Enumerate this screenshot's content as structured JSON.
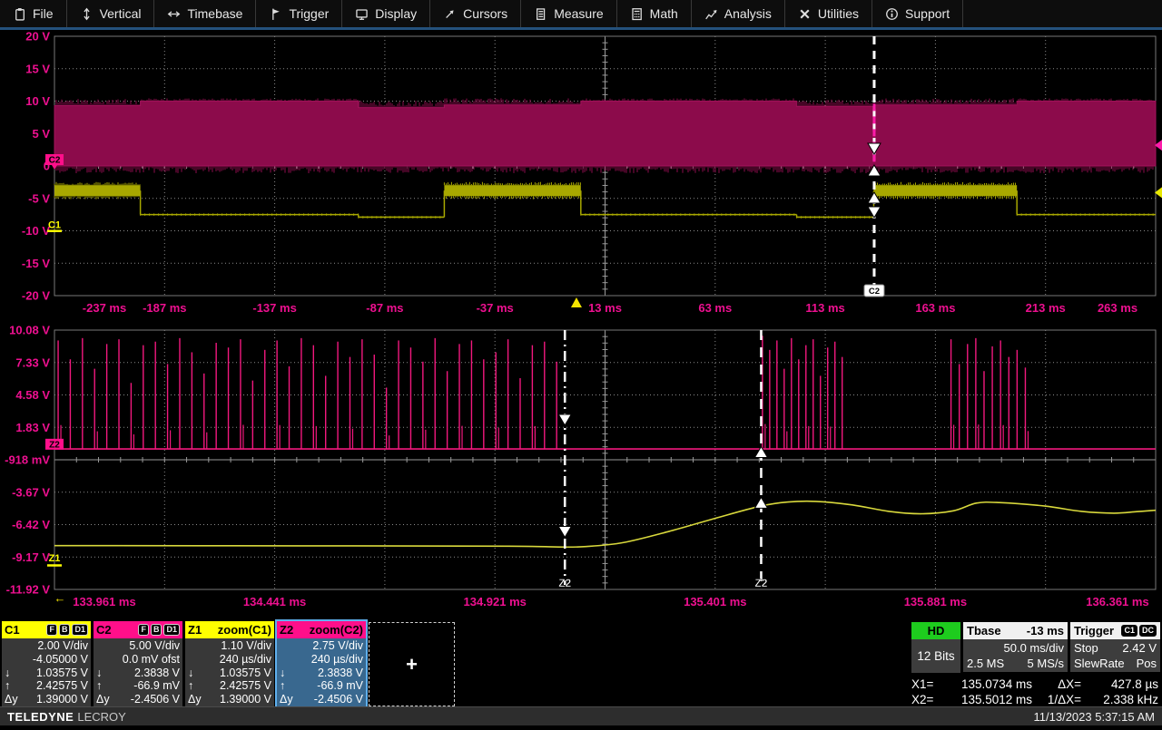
{
  "menu": {
    "items": [
      {
        "label": "File",
        "icon": "file"
      },
      {
        "label": "Vertical",
        "icon": "vertical"
      },
      {
        "label": "Timebase",
        "icon": "timebase"
      },
      {
        "label": "Trigger",
        "icon": "trigger"
      },
      {
        "label": "Display",
        "icon": "display"
      },
      {
        "label": "Cursors",
        "icon": "cursors"
      },
      {
        "label": "Measure",
        "icon": "measure"
      },
      {
        "label": "Math",
        "icon": "math"
      },
      {
        "label": "Analysis",
        "icon": "analysis"
      },
      {
        "label": "Utilities",
        "icon": "utilities"
      },
      {
        "label": "Support",
        "icon": "support"
      }
    ]
  },
  "colors": {
    "axis_pink": "#ee1090",
    "band_crimson": "#8c0b4b",
    "band_edge": "#a5135c",
    "trace_yellow": "#a8a800",
    "zoom_yellow": "#d8d83c",
    "spike_pink": "#f2187e",
    "grid_dotted": "#8a8a8a",
    "grid_center": "#9a9a9a",
    "grid_border": "#787878",
    "cursor_white": "#ffffff",
    "c1_yellow": "#ffff00",
    "c2_pink": "#ff0f8a",
    "hd_green": "#1ecc1e",
    "z1_underline": "#00b400",
    "z2_underline": "#00c8b4"
  },
  "chart_data": [
    {
      "id": "main",
      "type": "line",
      "x_unit": "ms",
      "x_range": [
        -237,
        263
      ],
      "y_range": [
        -20,
        20
      ],
      "x_divisions": 10,
      "y_divisions": 8,
      "x_ticks": [
        "-237 ms",
        "-187 ms",
        "-137 ms",
        "-87 ms",
        "-37 ms",
        "13 ms",
        "63 ms",
        "113 ms",
        "163 ms",
        "213 ms",
        "263 ms"
      ],
      "y_ticks": [
        "20 V",
        "15 V",
        "10 V",
        "5 V",
        "0",
        "-5 V",
        "-10 V",
        "-15 V",
        "-20 V"
      ],
      "grid": "dotted",
      "trigger_marker_ms": 0,
      "series": [
        {
          "name": "C2",
          "kind": "pwm-band",
          "base_v": 0,
          "top_segments_ms_v": [
            [
              -237,
              -198,
              9.3,
              2
            ],
            [
              -198,
              -99,
              10,
              1
            ],
            [
              -99,
              -60,
              9.0,
              2
            ],
            [
              -60,
              2,
              9.4,
              2
            ],
            [
              2,
              100,
              10,
              1
            ],
            [
              100,
              135,
              9.2,
              2
            ],
            [
              135,
              200,
              9.4,
              2
            ],
            [
              200,
              263,
              10,
              1
            ]
          ]
        },
        {
          "name": "C1",
          "kind": "steps",
          "segments_ms_v": [
            [
              -237,
              -198,
              -3.8,
              "thick"
            ],
            [
              -198,
              -99,
              -7.5,
              "thin"
            ],
            [
              -99,
              -60,
              -7.9,
              "thin"
            ],
            [
              -60,
              2,
              -3.8,
              "thick"
            ],
            [
              2,
              100,
              -7.5,
              "thin"
            ],
            [
              100,
              135,
              -7.9,
              "thin"
            ],
            [
              135,
              200,
              -3.8,
              "thick"
            ],
            [
              200,
              263,
              -7.5,
              "thin"
            ]
          ]
        }
      ],
      "cursor": {
        "x_ms": 135.2,
        "label": "C2",
        "style": "dashed"
      },
      "left_badges": [
        {
          "label": "C2",
          "v": 0
        },
        {
          "label": "C1",
          "v": -10
        }
      ],
      "right_markers": [
        {
          "color": "#ff1caa",
          "v": 3.2
        },
        {
          "color": "#e8e800",
          "v": -4.1
        }
      ]
    },
    {
      "id": "zoom",
      "type": "line",
      "x_unit": "ms",
      "x_range": [
        133.961,
        136.361
      ],
      "y_range": [
        -11.92,
        10.08
      ],
      "x_divisions": 10,
      "y_divisions": 8,
      "x_ticks": [
        "133.961 ms",
        "134.441 ms",
        "134.921 ms",
        "135.401 ms",
        "135.881 ms",
        "136.361 ms"
      ],
      "y_ticks": [
        "10.08 V",
        "7.33 V",
        "4.58 V",
        "1.83 V",
        "-918 mV",
        "-3.67 V",
        "-6.42 V",
        "-9.17 V",
        "-11.92 V"
      ],
      "grid": "dotted",
      "series": [
        {
          "name": "Z2",
          "kind": "spikes",
          "baseline_v": 0,
          "clusters": [
            {
              "start_ms": 133.969,
              "spacing_ms": 0.0265,
              "heights_v": [
                9.2,
                7.6,
                9.4,
                6.8,
                8.9,
                9.3,
                5.6,
                8.8,
                9.1,
                7.2,
                9.4,
                8.2,
                6.4,
                9.0,
                8.6,
                9.3,
                5.8,
                8.4,
                9.2,
                7.0,
                9.4,
                8.8,
                6.2,
                9.1,
                7.8,
                9.3,
                8.0,
                5.2,
                9.2,
                8.6,
                7.4,
                9.4,
                6.6,
                8.9,
                9.2,
                7.6,
                8.2,
                9.3,
                6.0,
                8.8,
                9.1,
                7.4
              ]
            },
            {
              "start_ms": 135.504,
              "spacing_ms": 0.0158,
              "heights_v": [
                9.6,
                8.4,
                9.2,
                6.8,
                9.4,
                7.6,
                8.8,
                9.3,
                6.2,
                8.6,
                9.1,
                7.8
              ]
            },
            {
              "start_ms": 135.915,
              "spacing_ms": 0.018,
              "heights_v": [
                9.3,
                7.2,
                8.9,
                9.4,
                6.6,
                8.7,
                9.2,
                7.8,
                8.4,
                6.9
              ]
            }
          ]
        },
        {
          "name": "Z1",
          "kind": "curve",
          "points_ms_v": [
            [
              133.961,
              -8.2
            ],
            [
              134.5,
              -8.22
            ],
            [
              134.95,
              -8.25
            ],
            [
              135.06,
              -8.32
            ],
            [
              135.12,
              -8.28
            ],
            [
              135.2,
              -7.95
            ],
            [
              135.3,
              -7.0
            ],
            [
              135.4,
              -5.9
            ],
            [
              135.5,
              -4.85
            ],
            [
              135.56,
              -4.5
            ],
            [
              135.62,
              -4.45
            ],
            [
              135.7,
              -4.75
            ],
            [
              135.78,
              -5.3
            ],
            [
              135.85,
              -5.5
            ],
            [
              135.92,
              -5.25
            ],
            [
              135.97,
              -4.6
            ],
            [
              136.02,
              -4.55
            ],
            [
              136.12,
              -4.85
            ],
            [
              136.2,
              -5.3
            ],
            [
              136.27,
              -5.45
            ],
            [
              136.32,
              -5.32
            ],
            [
              136.361,
              -5.2
            ]
          ]
        }
      ],
      "cursors": [
        {
          "x_ms": 135.0734,
          "style": "dashdot",
          "label": "Z2",
          "arrow_dir": "down",
          "arrow_v": [
            2.0,
            -7.5
          ]
        },
        {
          "x_ms": 135.5012,
          "style": "dashed",
          "label": "Z2",
          "arrow_dir": "up",
          "arrow_v": [
            0.2,
            -4.1
          ]
        }
      ],
      "left_badges": [
        {
          "label": "Z2",
          "v": 0.4
        },
        {
          "label": "Z1",
          "v": -9.4
        }
      ],
      "axis_arrow": "←"
    }
  ],
  "descriptors": [
    {
      "id": "C1",
      "name": "C1",
      "title": "",
      "header_bg": "#ffff00",
      "badges": [
        "F",
        "B",
        "D1"
      ],
      "selected": false,
      "underline": "",
      "rows": [
        {
          "l": "",
          "v": "2.00 V/div"
        },
        {
          "l": "",
          "v": "-4.05000 V"
        },
        {
          "l": "↓",
          "v": "1.03575 V"
        },
        {
          "l": "↑",
          "v": "2.42575 V"
        },
        {
          "l": "Δy",
          "v": "1.39000 V"
        }
      ]
    },
    {
      "id": "C2",
      "name": "C2",
      "title": "",
      "header_bg": "#ff0f8a",
      "badges": [
        "F",
        "B",
        "D1"
      ],
      "selected": false,
      "underline": "",
      "rows": [
        {
          "l": "",
          "v": "5.00 V/div"
        },
        {
          "l": "",
          "v": "0.0 mV ofst"
        },
        {
          "l": "↓",
          "v": "2.3838 V"
        },
        {
          "l": "↑",
          "v": "-66.9 mV"
        },
        {
          "l": "Δy",
          "v": "-2.4506 V"
        }
      ]
    },
    {
      "id": "Z1",
      "name": "Z1",
      "title": "zoom(C1)",
      "header_bg": "#ffff00",
      "badges": [],
      "selected": false,
      "underline": "#00b400",
      "rows": [
        {
          "l": "",
          "v": "1.10 V/div"
        },
        {
          "l": "",
          "v": "240 µs/div"
        },
        {
          "l": "↓",
          "v": "1.03575 V"
        },
        {
          "l": "↑",
          "v": "2.42575 V"
        },
        {
          "l": "Δy",
          "v": "1.39000 V"
        }
      ]
    },
    {
      "id": "Z2",
      "name": "Z2",
      "title": "zoom(C2)",
      "header_bg": "#ff0f8a",
      "badges": [],
      "selected": true,
      "underline": "#00c8b4",
      "rows": [
        {
          "l": "",
          "v": "2.75 V/div"
        },
        {
          "l": "",
          "v": "240 µs/div"
        },
        {
          "l": "↓",
          "v": "2.3838 V"
        },
        {
          "l": "↑",
          "v": "-66.9 mV"
        },
        {
          "l": "Δy",
          "v": "-2.4506 V"
        }
      ]
    }
  ],
  "add_trace": {
    "plus": "+"
  },
  "info": {
    "hd": {
      "header": "HD",
      "value": "12 Bits"
    },
    "tbase": {
      "label": "Tbase",
      "delay": "-13 ms",
      "scale": "50.0 ms/div",
      "samples": "2.5 MS",
      "rate": "5 MS/s"
    },
    "trigger": {
      "label": "Trigger",
      "badges": [
        "C1",
        "DC"
      ],
      "mode": "Stop",
      "level": "2.42 V",
      "type": "SlewRate",
      "slope": "Pos"
    }
  },
  "cursor_readout": {
    "x1_label": "X1=",
    "x1": "135.0734 ms",
    "x2_label": "X2=",
    "x2": "135.5012 ms",
    "dx_label": "ΔX=",
    "dx": "427.8 µs",
    "inv_label": "1/ΔX=",
    "inv": "2.338 kHz"
  },
  "statusbar": {
    "brand_bold": "TELEDYNE",
    "brand_light": "LECROY",
    "datetime": "11/13/2023 5:37:15 AM"
  }
}
